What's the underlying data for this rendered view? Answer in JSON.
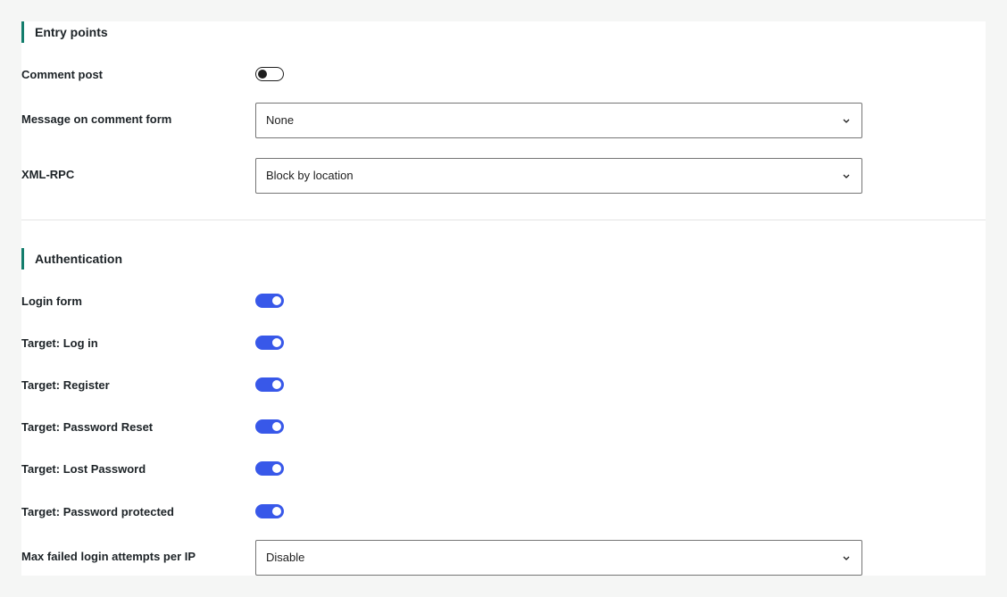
{
  "entry_points": {
    "title": "Entry points",
    "comment_post": {
      "label": "Comment post",
      "enabled": false
    },
    "message_on_comment_form": {
      "label": "Message on comment form",
      "value": "None"
    },
    "xml_rpc": {
      "label": "XML-RPC",
      "value": "Block by location"
    }
  },
  "authentication": {
    "title": "Authentication",
    "login_form": {
      "label": "Login form",
      "enabled": true
    },
    "target_log_in": {
      "label": "Target: Log in",
      "enabled": true
    },
    "target_register": {
      "label": "Target: Register",
      "enabled": true
    },
    "target_password_reset": {
      "label": "Target: Password Reset",
      "enabled": true
    },
    "target_lost_password": {
      "label": "Target: Lost Password",
      "enabled": true
    },
    "target_password_protected": {
      "label": "Target: Password protected",
      "enabled": true
    },
    "max_failed_login": {
      "label": "Max failed login attempts per IP",
      "value": "Disable"
    }
  },
  "colors": {
    "accent": "#137d6c",
    "toggle_on": "#3858e9",
    "toggle_off_border": "#1e1e1e"
  },
  "icons": {
    "select_chevron": "chevron-down-icon"
  }
}
